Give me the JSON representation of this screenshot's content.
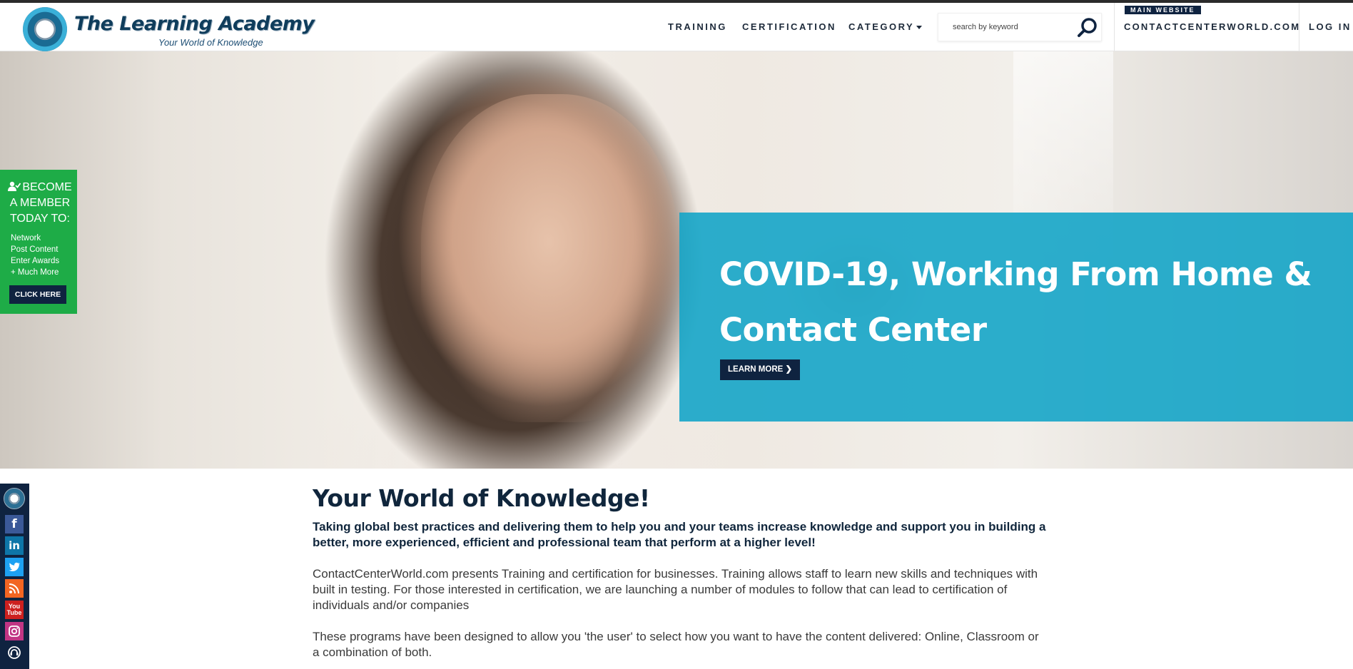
{
  "header": {
    "logo_title": "The Learning Academy",
    "logo_subtitle": "Your World of Knowledge",
    "nav": {
      "training": "TRAINING",
      "certification": "CERTIFICATION",
      "category": "CATEGORY"
    },
    "search_placeholder": "search by keyword",
    "main_website_badge": "MAIN WEBSITE",
    "main_website_link": "CONTACTCENTERWORLD.COM",
    "login": "LOG IN"
  },
  "hero": {
    "promo_title": "COVID-19, Working From Home & Contact Center",
    "learn_more": "LEARN MORE"
  },
  "member_promo": {
    "heading": "BECOME A MEMBER TODAY TO:",
    "items": [
      "Network",
      "Post Content",
      "Enter Awards",
      "+ Much More"
    ],
    "button": "CLICK HERE"
  },
  "social": {
    "items": [
      "facebook-icon",
      "linkedin-icon",
      "twitter-icon",
      "rss-icon",
      "youtube-icon",
      "instagram-icon",
      "contact-center-icon"
    ],
    "colors": {
      "facebook": "#3b5998",
      "linkedin": "#0e76a8",
      "twitter": "#1da1f2",
      "rss": "#f26522",
      "youtube": "#cd201f",
      "instagram": "#c13584",
      "ccw": "#0f2340"
    }
  },
  "content": {
    "title": "Your World of Knowledge!",
    "lead": "Taking global best practices and delivering them to help you and your teams increase knowledge and support you in building a better, more experienced, efficient and professional team that perform at a higher level!",
    "paragraph_1": "ContactCenterWorld.com presents Training and certification for businesses. Training allows staff to learn new skills and techniques with built in testing. For those interested in certification, we are launching a number of modules to follow that can lead to certification of individuals and/or companies",
    "paragraph_2": "These programs have been designed to allow you 'the user' to select how you want to have the content delivered: Online, Classroom or a combination of both."
  },
  "colors": {
    "navy": "#0f2340",
    "promo_blue": "#15a5c8",
    "member_green": "#1eac47"
  }
}
